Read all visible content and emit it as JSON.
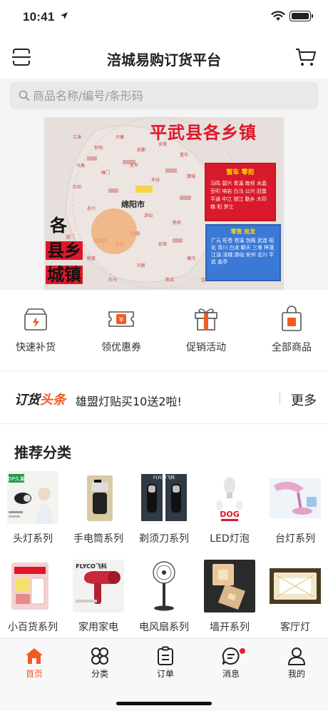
{
  "status_bar": {
    "time": "10:41"
  },
  "header": {
    "title": "涪城易购订货平台"
  },
  "search": {
    "placeholder": "商品名称/编号/条形码"
  },
  "banner": {
    "title": "平武县各乡镇",
    "city_label": "绵阳市",
    "left_chars": [
      "各",
      "县乡",
      "城镇"
    ],
    "legend_red_title": "暂车 零担",
    "legend_red_body": "马鸣 碧兴 青溪 南坝 水晶 豆叩 响岩 白马 公兴 旧堡 平通 中江 锁江 勤乡 大印 梯 阳 罗江",
    "legend_blue_title": "零售 批发",
    "legend_blue_body": "广元 旺苍 苍溪 剑阁 武连 昭化 青川 白龙 朝天 三堆 梓潼 江油 涪城 游仙 安州 北川 平武 盐亭"
  },
  "quick_actions": [
    {
      "label": "快速补货",
      "icon": "box-lightning-icon"
    },
    {
      "label": "领优惠券",
      "icon": "coupon-icon"
    },
    {
      "label": "促销活动",
      "icon": "gift-icon"
    },
    {
      "label": "全部商品",
      "icon": "bag-icon"
    }
  ],
  "news": {
    "tag_prefix": "订货",
    "tag_highlight": "头条",
    "text": "雄盟灯贴买10送2啦!",
    "more": "更多"
  },
  "categories": {
    "title": "推荐分类",
    "items": [
      {
        "label": "头灯系列"
      },
      {
        "label": "手电筒系列"
      },
      {
        "label": "剃须刀系列"
      },
      {
        "label": "LED灯泡"
      },
      {
        "label": "台灯系列"
      },
      {
        "label": "小百货系列"
      },
      {
        "label": "家用家电"
      },
      {
        "label": "电风扇系列"
      },
      {
        "label": "墙开系列"
      },
      {
        "label": "客厅灯"
      }
    ],
    "image_texts": {
      "headlamp": "DP久量",
      "shaver": "FLYCO飞科",
      "bulb": "DOG",
      "hairdryer": "FLYCO飞科"
    }
  },
  "tabbar": {
    "items": [
      {
        "label": "首页",
        "active": true
      },
      {
        "label": "分类"
      },
      {
        "label": "订单"
      },
      {
        "label": "消息"
      },
      {
        "label": "我的"
      }
    ]
  },
  "colors": {
    "accent": "#f45a20",
    "banner_red": "#e0162b",
    "badge": "#e8202f"
  }
}
